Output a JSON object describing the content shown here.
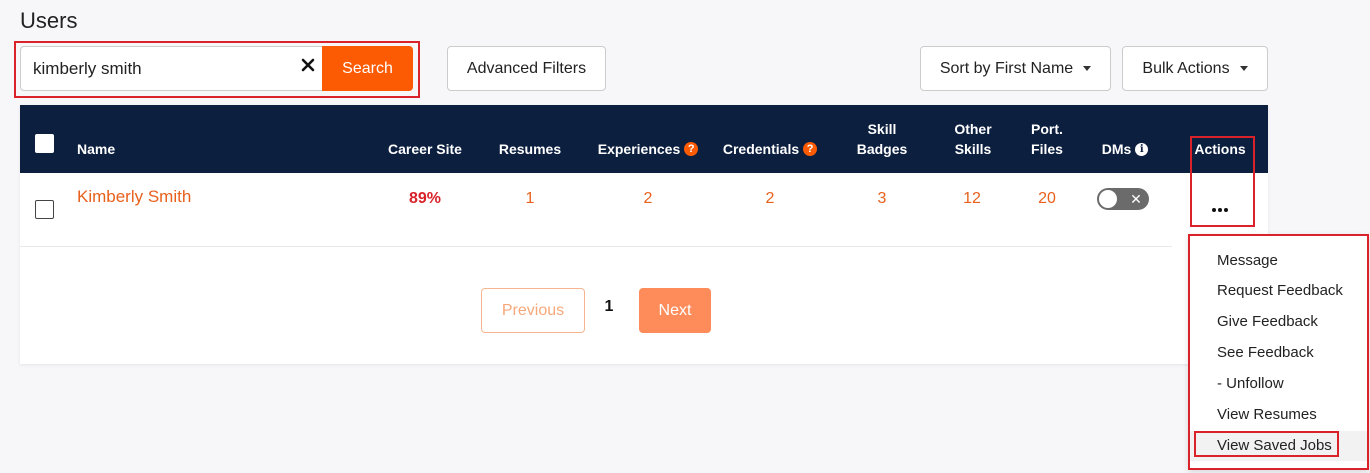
{
  "page": {
    "title": "Users"
  },
  "search": {
    "value": "kimberly smith",
    "placeholder": "",
    "button_label": "Search"
  },
  "toolbar": {
    "advanced_filters_label": "Advanced Filters",
    "sort_label": "Sort by First Name",
    "bulk_actions_label": "Bulk Actions"
  },
  "table": {
    "columns": {
      "name": "Name",
      "career_site": "Career Site",
      "resumes": "Resumes",
      "experiences": "Experiences",
      "credentials": "Credentials",
      "skill_badges_line1": "Skill",
      "skill_badges_line2": "Badges",
      "other_skills_line1": "Other",
      "other_skills_line2": "Skills",
      "port_files_line1": "Port.",
      "port_files_line2": "Files",
      "dms": "DMs",
      "actions": "Actions"
    },
    "rows": [
      {
        "name": "Kimberly Smith",
        "career_site": "89%",
        "resumes": "1",
        "experiences": "2",
        "credentials": "2",
        "skill_badges": "3",
        "other_skills": "12",
        "port_files": "20",
        "dms_enabled": false
      }
    ]
  },
  "pagination": {
    "previous_label": "Previous",
    "current_page": "1",
    "next_label": "Next"
  },
  "actions_menu": {
    "items": [
      {
        "label": "Message"
      },
      {
        "label": "Request Feedback"
      },
      {
        "label": "Give Feedback"
      },
      {
        "label": "See Feedback"
      },
      {
        "label": "- Unfollow"
      },
      {
        "label": "View Resumes"
      },
      {
        "label": "View Saved Jobs",
        "hovered": true
      }
    ]
  },
  "icons": {
    "help": "?",
    "info": "i",
    "clear": "close-icon",
    "ellipsis": "more-icon"
  },
  "colors": {
    "accent": "#fc5a03",
    "header_bg": "#0c1f3f",
    "link": "#e8601c",
    "highlight": "#d9222a"
  }
}
